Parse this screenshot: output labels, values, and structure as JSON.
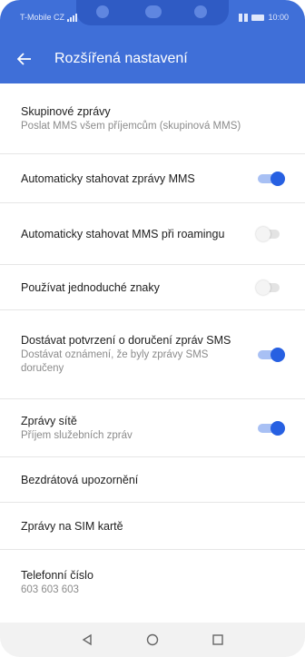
{
  "status": {
    "carrier": "T-Mobile CZ",
    "time": "10:00"
  },
  "header": {
    "back_icon": "arrow-left-icon",
    "title": "Rozšířená nastavení"
  },
  "settings": [
    {
      "title": "Skupinové zprávy",
      "subtitle": "Poslat MMS všem příjemcům (skupinová MMS)"
    },
    {
      "title": "Automaticky stahovat zprávy MMS",
      "toggle": true
    },
    {
      "title": "Automaticky stahovat MMS při roamingu",
      "toggle": false
    },
    {
      "title": "Používat jednoduché znaky",
      "toggle": false
    },
    {
      "title": "Dostávat potvrzení o doručení zpráv SMS",
      "subtitle": "Dostávat oznámení, že byly zprávy SMS doručeny",
      "toggle": true
    },
    {
      "title": "Zprávy sítě",
      "subtitle": "Příjem služebních zpráv",
      "toggle": true
    },
    {
      "title": "Bezdrátová upozornění"
    },
    {
      "title": "Zprávy na SIM kartě"
    },
    {
      "title": "Telefonní číslo",
      "subtitle": "603 603 603"
    }
  ],
  "nav": {
    "back_icon": "triangle-back-icon",
    "home_icon": "circle-home-icon",
    "recents_icon": "square-recents-icon"
  },
  "colors": {
    "accent": "#3f6fd8",
    "toggle_on": "#2760e2"
  }
}
